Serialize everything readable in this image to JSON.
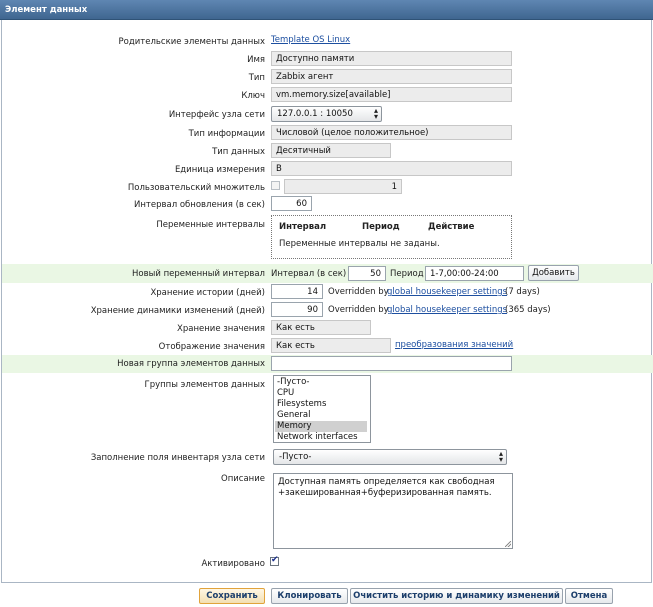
{
  "window": {
    "title": "Элемент данных"
  },
  "form": {
    "parent": {
      "label": "Родительские элементы данных",
      "value": "Template OS Linux"
    },
    "name": {
      "label": "Имя",
      "value": "Доступно памяти"
    },
    "type": {
      "label": "Тип",
      "value": "Zabbix агент"
    },
    "key": {
      "label": "Ключ",
      "value": "vm.memory.size[available]"
    },
    "interface": {
      "label": "Интерфейс узла сети",
      "value": "127.0.0.1 : 10050"
    },
    "info_type": {
      "label": "Тип информации",
      "value": "Числовой (целое положительное)"
    },
    "data_type": {
      "label": "Тип данных",
      "value": "Десятичный"
    },
    "units": {
      "label": "Единица измерения",
      "value": "B"
    },
    "multiplier": {
      "label": "Пользовательский множитель",
      "value": "1",
      "checked": false
    },
    "update_interval": {
      "label": "Интервал обновления (в сек)",
      "value": "60"
    },
    "flex_intervals": {
      "label": "Переменные интервалы",
      "col_interval": "Интервал",
      "col_period": "Период",
      "col_action": "Действие",
      "empty": "Переменные интервалы не заданы."
    },
    "new_flex": {
      "label": "Новый переменный интервал",
      "interval_label": "Интервал (в сек)",
      "interval_value": "50",
      "period_label": "Период",
      "period_value": "1-7,00:00-24:00",
      "add_button": "Добавить"
    },
    "history": {
      "label": "Хранение истории (дней)",
      "value": "14",
      "overridden_by": "Overridden by",
      "link": "global housekeeper settings",
      "suffix": "(7 days)"
    },
    "trends": {
      "label": "Хранение динамики изменений (дней)",
      "value": "90",
      "overridden_by": "Overridden by",
      "link": "global housekeeper settings",
      "suffix": "(365 days)"
    },
    "store_value": {
      "label": "Хранение значения",
      "value": "Как есть"
    },
    "show_value": {
      "label": "Отображение значения",
      "value": "Как есть",
      "link": "преобразования значений"
    },
    "new_application": {
      "label": "Новая группа элементов данных",
      "value": ""
    },
    "applications": {
      "label": "Группы элементов данных",
      "options": [
        "-Пусто-",
        "CPU",
        "Filesystems",
        "General",
        "Memory",
        "Network interfaces"
      ],
      "selected": "Memory"
    },
    "inventory": {
      "label": "Заполнение поля инвентаря узла сети",
      "value": "-Пусто-"
    },
    "description": {
      "label": "Описание",
      "line1": "Доступная память определяется как свободная",
      "line2": "+закешированная+буферизированная память."
    },
    "enabled": {
      "label": "Активировано",
      "checked": true
    }
  },
  "buttons": {
    "save": "Сохранить",
    "clone": "Клонировать",
    "clear": "Очистить историю и динамику изменений",
    "cancel": "Отмена"
  }
}
